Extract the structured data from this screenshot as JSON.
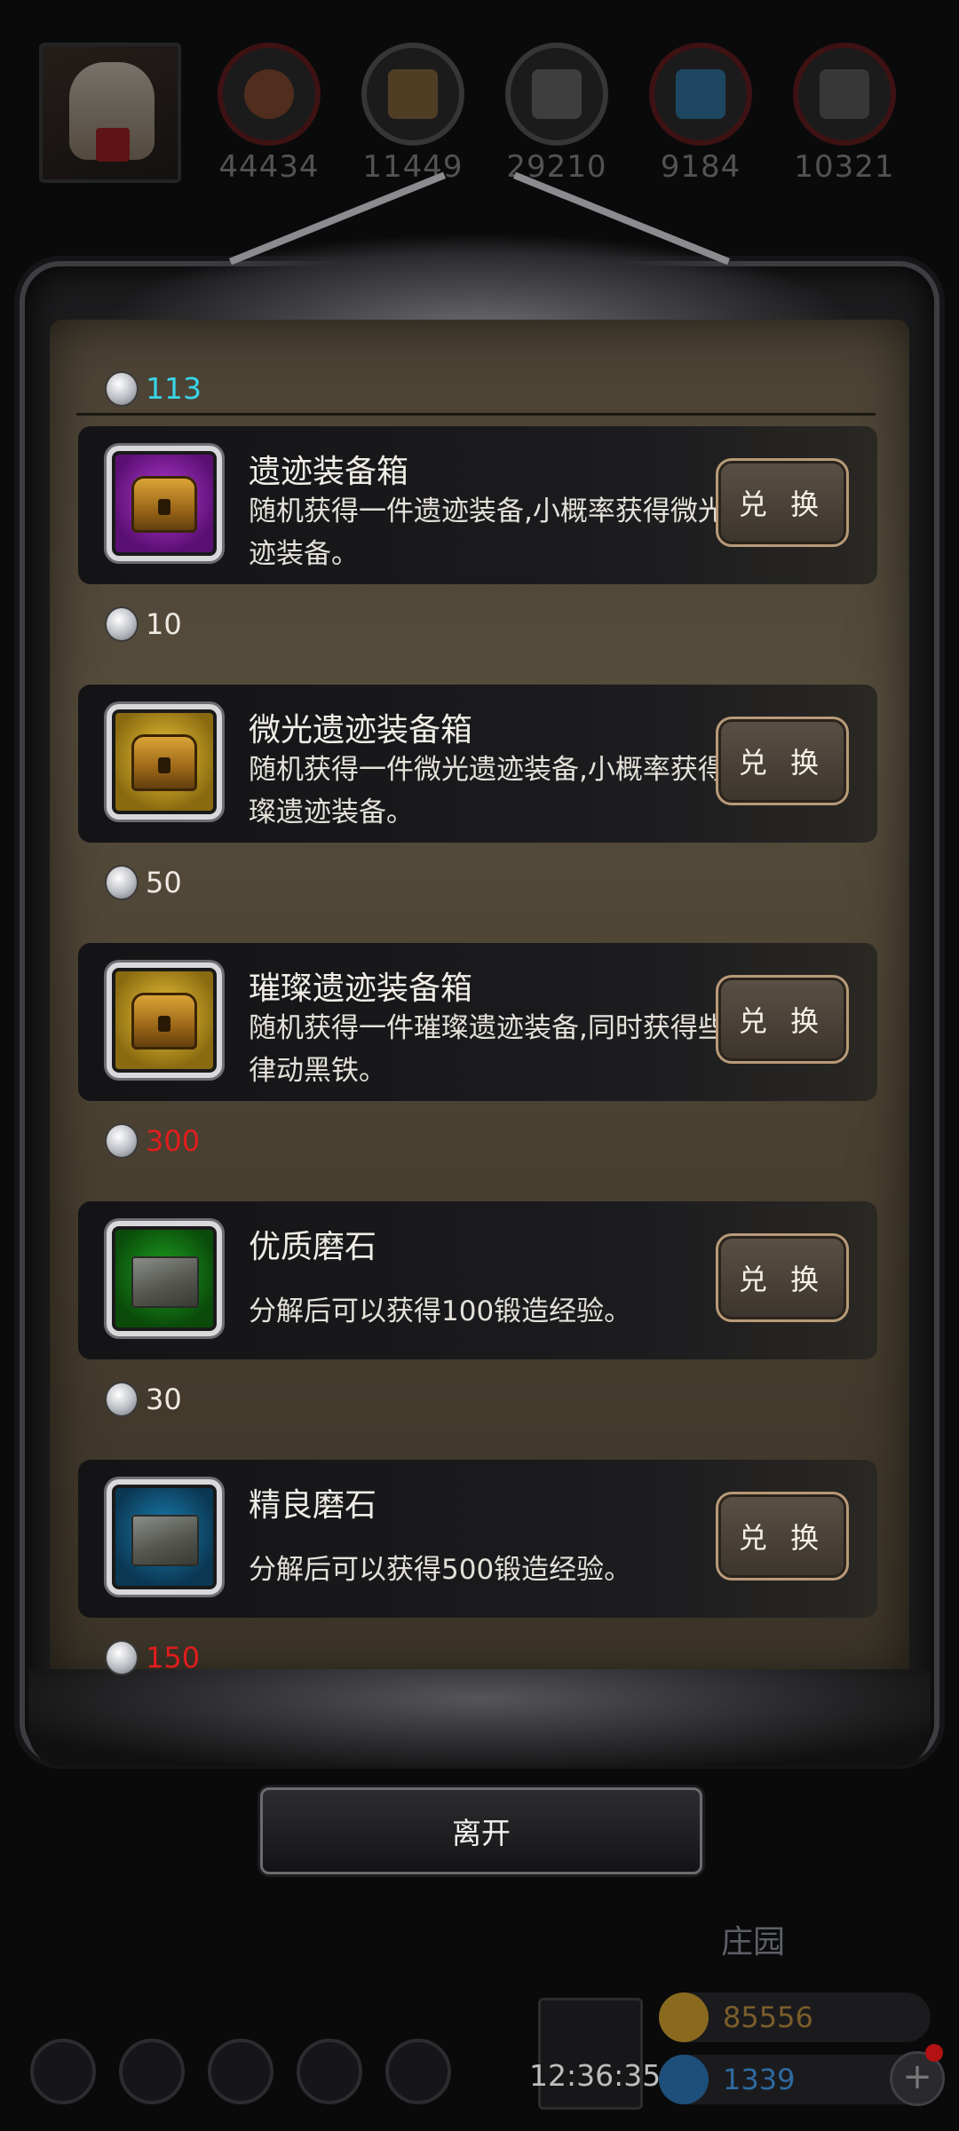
{
  "resources": [
    {
      "icon": "meat-icon",
      "value": "44434"
    },
    {
      "icon": "wood-icon",
      "value": "11449"
    },
    {
      "icon": "iron-icon",
      "value": "29210"
    },
    {
      "icon": "crystal-icon",
      "value": "9184"
    },
    {
      "icon": "ingot-icon",
      "value": "10321"
    }
  ],
  "shop": {
    "currency_icon": "silver-coin-icon",
    "balance": "113",
    "items": [
      {
        "name": "遗迹装备箱",
        "desc": "随机获得一件遗迹装备,小概率获得微光遗迹装备。",
        "button": "兑 换",
        "cost": "10",
        "cost_color": "white",
        "frame": "purple",
        "icon": "chest-icon"
      },
      {
        "name": "微光遗迹装备箱",
        "desc": "随机获得一件微光遗迹装备,小概率获得璀璨遗迹装备。",
        "button": "兑 换",
        "cost": "50",
        "cost_color": "white",
        "frame": "gold",
        "icon": "chest-icon"
      },
      {
        "name": "璀璨遗迹装备箱",
        "desc": "随机获得一件璀璨遗迹装备,同时获得些许律动黑铁。",
        "button": "兑 换",
        "cost": "300",
        "cost_color": "red",
        "frame": "gold",
        "icon": "chest-icon"
      },
      {
        "name": "优质磨石",
        "desc": "分解后可以获得100锻造经验。",
        "button": "兑 换",
        "cost": "30",
        "cost_color": "white",
        "frame": "green",
        "icon": "whetstone-icon"
      },
      {
        "name": "精良磨石",
        "desc": "分解后可以获得500锻造经验。",
        "button": "兑 换",
        "cost": "150",
        "cost_color": "red",
        "frame": "blue",
        "icon": "whetstone-icon"
      }
    ],
    "leave_label": "离开"
  },
  "background": {
    "title": "庄园",
    "gold": "85556",
    "gems": "1339",
    "clock": "12:36:35",
    "plus_label": "+"
  }
}
